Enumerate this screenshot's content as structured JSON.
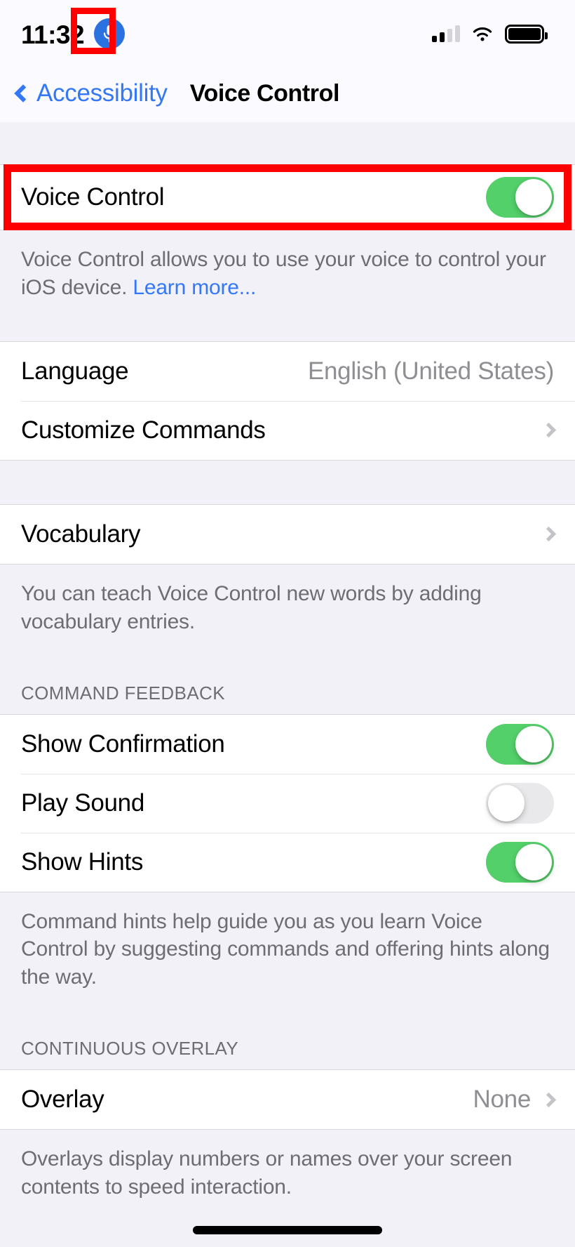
{
  "status_bar": {
    "time": "11:32",
    "mic_icon": "microphone-icon",
    "signal_icon": "cellular-signal-icon",
    "signal_bars_filled": 2,
    "signal_bars_total": 4,
    "wifi_icon": "wifi-icon",
    "battery_icon": "battery-full-icon",
    "battery_level": 100
  },
  "nav": {
    "back_label": "Accessibility",
    "back_icon": "chevron-left-icon",
    "title": "Voice Control"
  },
  "main": {
    "voice_control": {
      "label": "Voice Control",
      "enabled": true,
      "footer_text": "Voice Control allows you to use your voice to control your iOS device. ",
      "footer_link": "Learn more..."
    },
    "settings_group": {
      "language": {
        "label": "Language",
        "value": "English (United States)"
      },
      "customize_commands": {
        "label": "Customize Commands"
      }
    },
    "vocabulary_group": {
      "vocabulary": {
        "label": "Vocabulary"
      },
      "footer_text": "You can teach Voice Control new words by adding vocabulary entries."
    },
    "command_feedback": {
      "header": "COMMAND FEEDBACK",
      "rows": [
        {
          "label": "Show Confirmation",
          "enabled": true
        },
        {
          "label": "Play Sound",
          "enabled": false
        },
        {
          "label": "Show Hints",
          "enabled": true
        }
      ],
      "footer_text": "Command hints help guide you as you learn Voice Control by suggesting commands and offering hints along the way."
    },
    "continuous_overlay": {
      "header": "CONTINUOUS OVERLAY",
      "overlay": {
        "label": "Overlay",
        "value": "None"
      },
      "footer_text": "Overlays display numbers or names over your screen contents to speed interaction."
    }
  },
  "annotations": {
    "color": "#ff0000",
    "mic_badge_highlight": "microphone-status-icon-highlight",
    "voice_control_row_highlight": "voice-control-row-highlight"
  },
  "colors": {
    "accent_blue": "#3478f6",
    "toggle_on_green": "#53d06a",
    "toggle_off_gray": "#e9e9eb",
    "group_background": "#f2f1f7",
    "secondary_text": "#6d6d72"
  }
}
